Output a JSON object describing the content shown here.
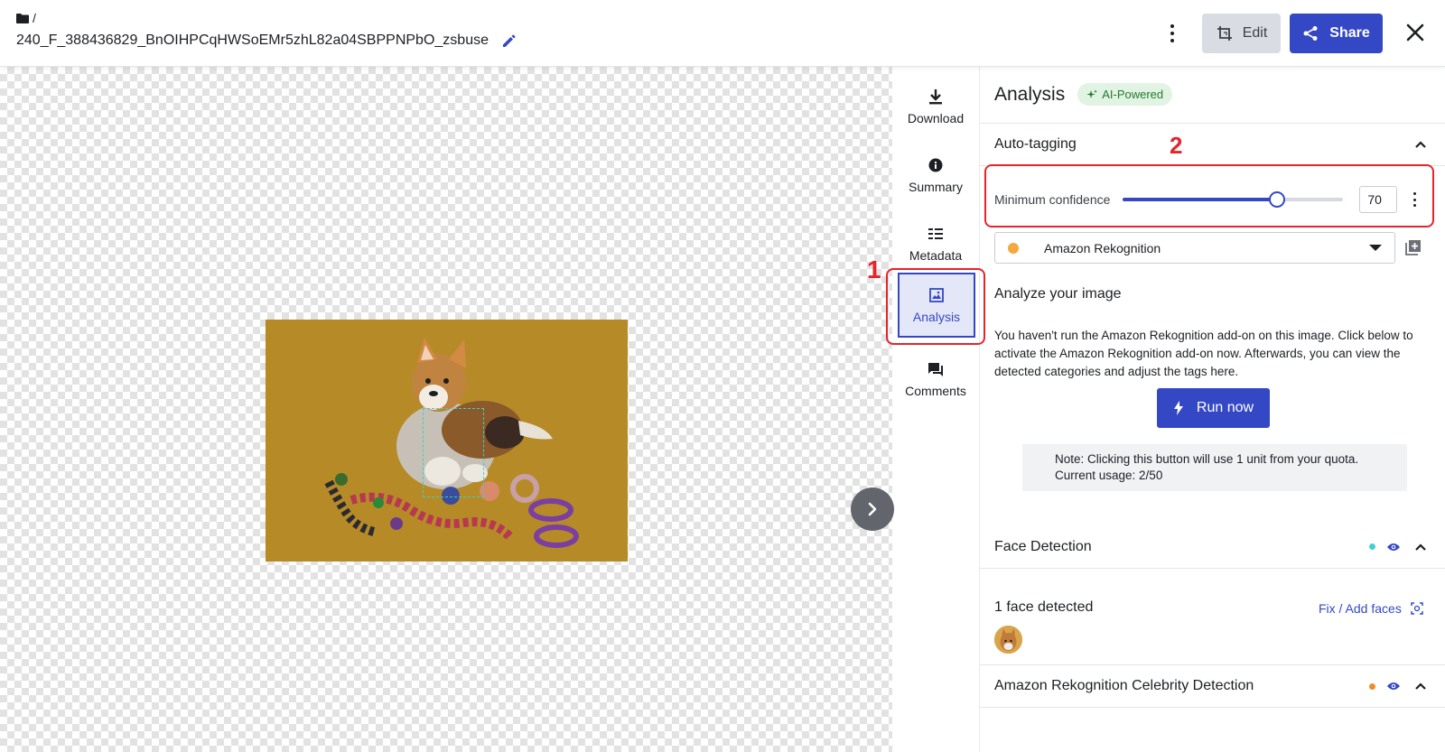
{
  "header": {
    "breadcrumb_sep": "/",
    "filename": "240_F_388436829_BnOIHPCqHWSoEMr5zhL82a04SBPPNPbO_zsbuse",
    "edit_label": "Edit",
    "share_label": "Share"
  },
  "toolbar": {
    "items": [
      {
        "label": "Download",
        "icon": "download-icon"
      },
      {
        "label": "Summary",
        "icon": "info-icon"
      },
      {
        "label": "Metadata",
        "icon": "metadata-icon"
      },
      {
        "label": "Analysis",
        "icon": "analysis-icon",
        "active": true
      },
      {
        "label": "Comments",
        "icon": "comments-icon"
      }
    ]
  },
  "annotations": {
    "marker_1": "1",
    "marker_2": "2",
    "color": "#e8232a"
  },
  "panel": {
    "title": "Analysis",
    "ai_badge": "AI-Powered",
    "auto_tagging": {
      "title": "Auto-tagging",
      "confidence_label": "Minimum confidence",
      "confidence_value": "70",
      "provider": "Amazon Rekognition",
      "analyze_title": "Analyze your image",
      "analyze_text": "You haven't run the Amazon Rekognition add-on on this image. Click below to activate the Amazon Rekognition add-on now. Afterwards, you can view the detected categories and adjust the tags here.",
      "run_label": "Run now",
      "note_line1": "Note: Clicking this button will use 1 unit from your quota.",
      "note_line2": "Current usage: 2/50"
    },
    "face_detection": {
      "title": "Face Detection",
      "status_color": "#3fd1d6",
      "count_text": "1 face detected",
      "fix_label": "Fix / Add faces"
    },
    "celebrity_detection": {
      "title": "Amazon Rekognition Celebrity Detection",
      "status_color": "#f08b2c"
    }
  },
  "colors": {
    "accent": "#3448c5",
    "ai_badge_bg": "#e1f3e2",
    "ai_badge_text": "#267a2f"
  }
}
